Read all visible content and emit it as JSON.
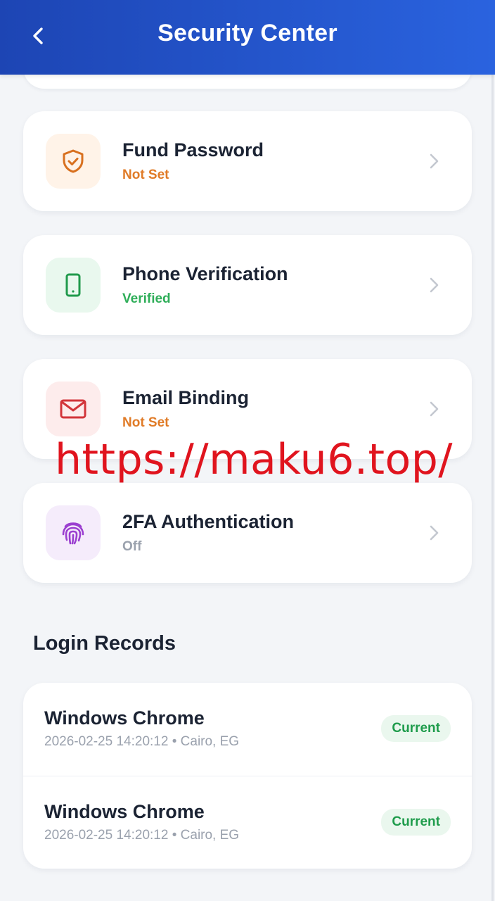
{
  "header": {
    "title": "Security Center",
    "back_icon": "chevron-left-icon"
  },
  "security_items": [
    {
      "title": "Fund Password",
      "status": "Not Set",
      "status_color": "#e07b27",
      "icon": "shield-check-icon",
      "icon_color": "#d8701f",
      "icon_bg": "#fff3e8"
    },
    {
      "title": "Phone Verification",
      "status": "Verified",
      "status_color": "#2fae59",
      "icon": "phone-icon",
      "icon_color": "#219a4c",
      "icon_bg": "#e9f8ee"
    },
    {
      "title": "Email Binding",
      "status": "Not Set",
      "status_color": "#e07b27",
      "icon": "mail-icon",
      "icon_color": "#d2353a",
      "icon_bg": "#fdecec"
    },
    {
      "title": "2FA Authentication",
      "status": "Off",
      "status_color": "#9aa1ad",
      "icon": "fingerprint-icon",
      "icon_color": "#9b3fd0",
      "icon_bg": "#f5ecfb"
    }
  ],
  "login_records": {
    "title": "Login Records",
    "rows": [
      {
        "device": "Windows Chrome",
        "time": "2026-02-25 14:20:12",
        "location": "Cairo, EG",
        "badge": "Current"
      },
      {
        "device": "Windows Chrome",
        "time": "2026-02-25 14:20:12",
        "location": "Cairo, EG",
        "badge": "Current"
      }
    ]
  },
  "watermark": {
    "text": "https://maku6.top/"
  },
  "colors": {
    "header_start": "#1d45b4",
    "header_end": "#2a63df",
    "background": "#f3f5f8",
    "badge_text": "#1f9c4c",
    "badge_bg": "#eaf7ee"
  }
}
